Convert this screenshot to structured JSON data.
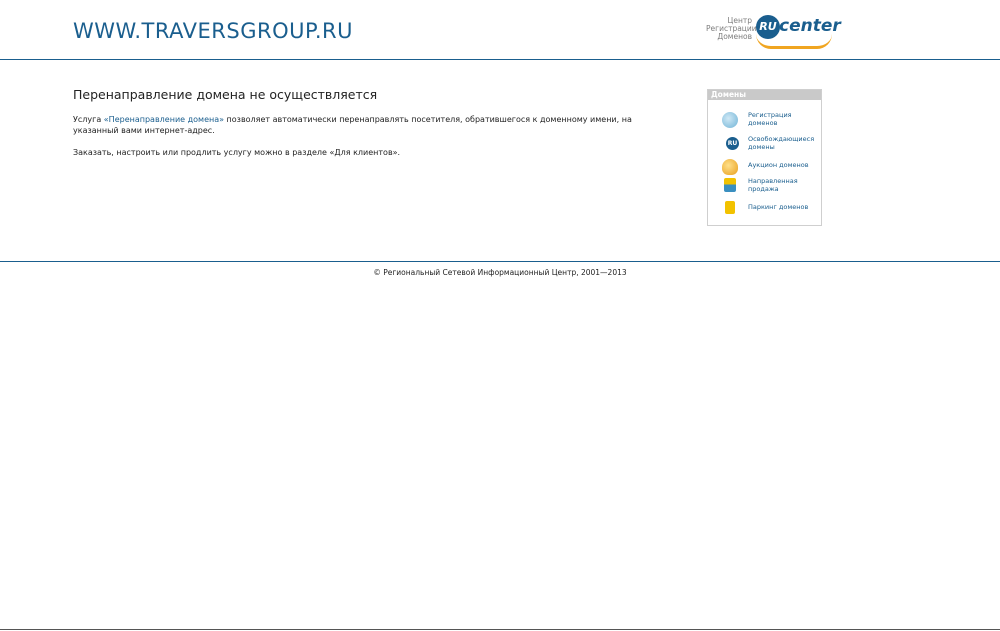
{
  "header": {
    "site_title": "WWW.TRAVERSGROUP.RU",
    "logo_line1": "Центр",
    "logo_line2": "Регистрации",
    "logo_line3": "Доменов",
    "logo_badge": "RU",
    "logo_word": "center"
  },
  "main": {
    "heading": "Перенаправление домена не осуществляется",
    "p1_prefix": "Услуга ",
    "p1_link": "«Перенаправление домена»",
    "p1_suffix": " позволяет автоматически перенаправлять посетителя, обратившегося к доменному имени, на указанный вами интернет-адрес.",
    "p2": "Заказать, настроить или продлить услугу можно в разделе «Для клиентов»."
  },
  "sidebox": {
    "title": "Домены",
    "items": [
      {
        "line1": "Регистрация",
        "line2": "доменов",
        "icon": "globe-icon",
        "color": "#6fb3d6"
      },
      {
        "line1": "Освобождающиеся",
        "line2": "домены",
        "icon": "ru-wings-icon",
        "color": "#1a5e8e"
      },
      {
        "line1": "Аукцион доменов",
        "line2": "",
        "icon": "coins-icon",
        "color": "#f0b030"
      },
      {
        "line1": "Направленная",
        "line2": "продажа",
        "icon": "arrow-sale-icon",
        "color": "#3a8fc0"
      },
      {
        "line1": "Паркинг доменов",
        "line2": "",
        "icon": "parking-icon",
        "color": "#f2c200"
      }
    ]
  },
  "footer": {
    "copyright": "© Региональный Сетевой Информационный Центр, 2001—2013"
  },
  "colors": {
    "accent": "#1a5e8e",
    "logo_orange": "#f0a520"
  }
}
